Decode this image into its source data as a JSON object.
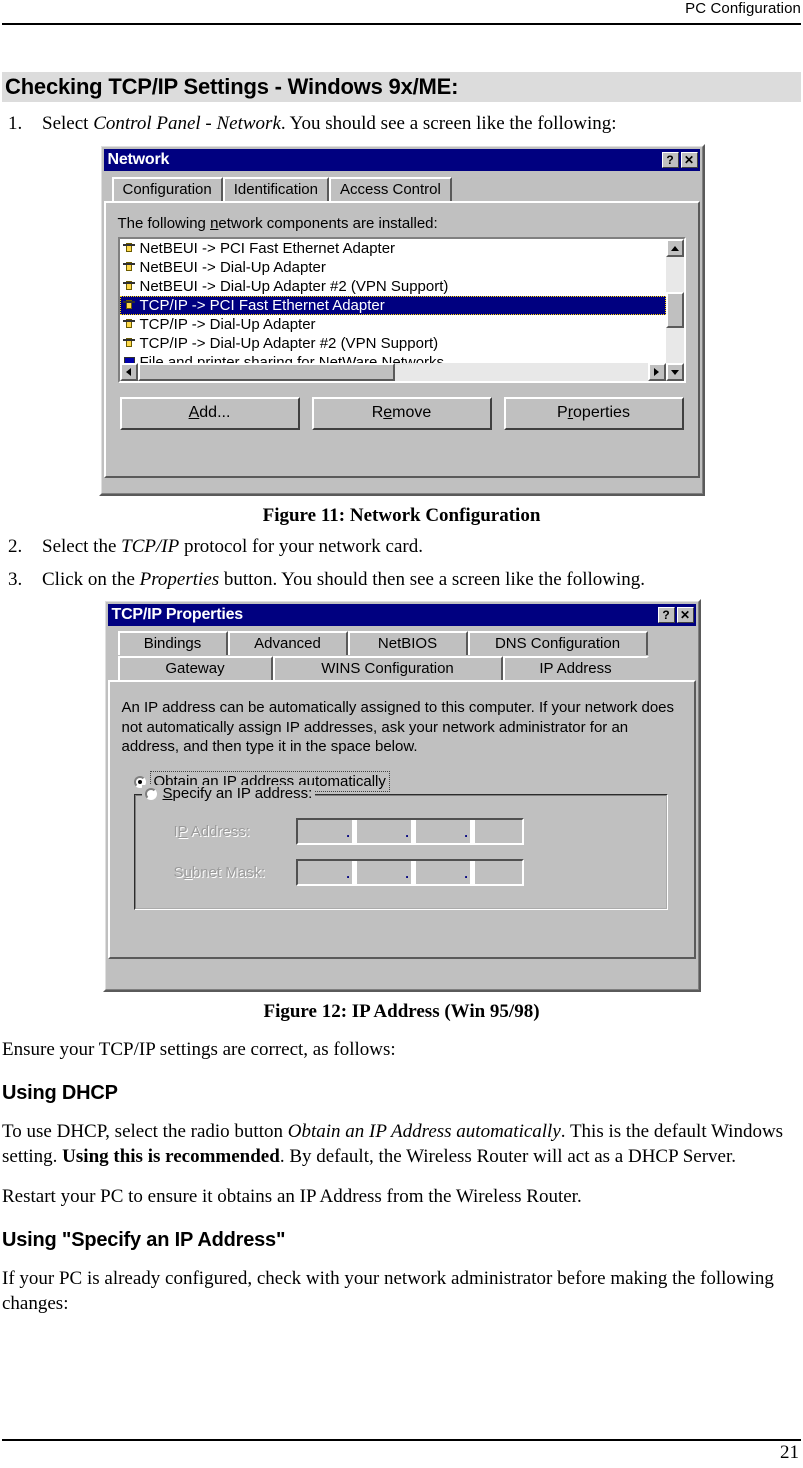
{
  "header": {
    "running_title": "PC Configuration"
  },
  "footer": {
    "page_number": "21"
  },
  "section": {
    "title": "Checking TCP/IP Settings - Windows 9x/ME:"
  },
  "steps": [
    {
      "num": "1.",
      "pre": "Select ",
      "em": "Control Panel - Network",
      "post": ". You should see a screen like the following:"
    },
    {
      "num": "2.",
      "pre": "Select the ",
      "em": "TCP/IP",
      "post": " protocol for your network card."
    },
    {
      "num": "3.",
      "pre": "Click on the ",
      "em": "Properties",
      "post": " button. You should then see a screen like the following."
    }
  ],
  "figures": {
    "fig11_caption": "Figure 11: Network Configuration",
    "fig12_caption": "Figure 12: IP Address (Win 95/98)"
  },
  "network_dialog": {
    "title": "Network",
    "help_button": "?",
    "close_button": "✕",
    "tabs": [
      {
        "label": "Configuration",
        "active": true
      },
      {
        "label": "Identification",
        "active": false
      },
      {
        "label": "Access Control",
        "active": false
      }
    ],
    "list_label_a": "The following ",
    "list_label_mnemonic": "n",
    "list_label_b": "etwork components are installed:",
    "components": [
      {
        "label": "NetBEUI -> PCI Fast Ethernet Adapter",
        "icon": "protocol-icon",
        "selected": false
      },
      {
        "label": "NetBEUI -> Dial-Up Adapter",
        "icon": "protocol-icon",
        "selected": false
      },
      {
        "label": "NetBEUI -> Dial-Up Adapter #2 (VPN Support)",
        "icon": "protocol-icon",
        "selected": false
      },
      {
        "label": "TCP/IP -> PCI Fast Ethernet Adapter",
        "icon": "protocol-icon",
        "selected": true
      },
      {
        "label": "TCP/IP -> Dial-Up Adapter",
        "icon": "protocol-icon",
        "selected": false
      },
      {
        "label": "TCP/IP -> Dial-Up Adapter #2 (VPN Support)",
        "icon": "protocol-icon",
        "selected": false
      },
      {
        "label": "File and printer sharing for NetWare Networks",
        "icon": "share-icon",
        "selected": false
      }
    ],
    "buttons": [
      {
        "pre": "",
        "mnemonic": "A",
        "post": "dd..."
      },
      {
        "pre": "R",
        "mnemonic": "e",
        "post": "move"
      },
      {
        "pre": "P",
        "mnemonic": "r",
        "post": "operties"
      }
    ]
  },
  "tcpip_dialog": {
    "title": "TCP/IP Properties",
    "help_button": "?",
    "close_button": "✕",
    "tabs_row1": [
      {
        "label": "Bindings",
        "active": false
      },
      {
        "label": "Advanced",
        "active": false
      },
      {
        "label": "NetBIOS",
        "active": false
      },
      {
        "label": "DNS Configuration",
        "active": false
      }
    ],
    "tabs_row2": [
      {
        "label": "Gateway",
        "active": false
      },
      {
        "label": "WINS Configuration",
        "active": false
      },
      {
        "label": "IP Address",
        "active": true
      }
    ],
    "description": "An IP address can be automatically assigned to this computer.  If your network does not automatically assign IP addresses, ask your network administrator for an address, and then type it in the space below.",
    "radio_auto": {
      "pre": "",
      "mnemonic": "O",
      "post": "btain an IP address automatically",
      "checked": true
    },
    "radio_specify": {
      "pre": "",
      "mnemonic": "S",
      "post": "pecify an IP address:",
      "checked": false
    },
    "ip_address_label_pre": "I",
    "ip_address_label_mnemonic": "P",
    "ip_address_label_post": " Address:",
    "subnet_label_pre": "S",
    "subnet_label_mnemonic": "u",
    "subnet_label_post": "bnet Mask:",
    "ip_address_value": "",
    "subnet_mask_value": "",
    "octet_separator": "."
  },
  "body": {
    "ensure_para": "Ensure your TCP/IP settings are correct, as follows:",
    "using_dhcp_heading": "Using DHCP",
    "dhcp_para_1": "To use DHCP, select the radio button ",
    "dhcp_para_em": "Obtain an IP Address automatically",
    "dhcp_para_2": ". This is the default Windows setting. ",
    "dhcp_para_bold": "Using this is recommended",
    "dhcp_para_3": ". By default, the Wireless Router will act as a DHCP Server.",
    "restart_para": "Restart your PC to ensure it obtains an IP Address from the Wireless Router.",
    "specify_heading": "Using \"Specify an IP Address\"",
    "specify_para": "If your PC is already configured, check with your network administrator before making the following changes:"
  },
  "colors": {
    "titlebar": "#000080",
    "dialog_face": "#c0c0c0",
    "section_bar": "#dcdcdc",
    "selection": "#000080"
  }
}
